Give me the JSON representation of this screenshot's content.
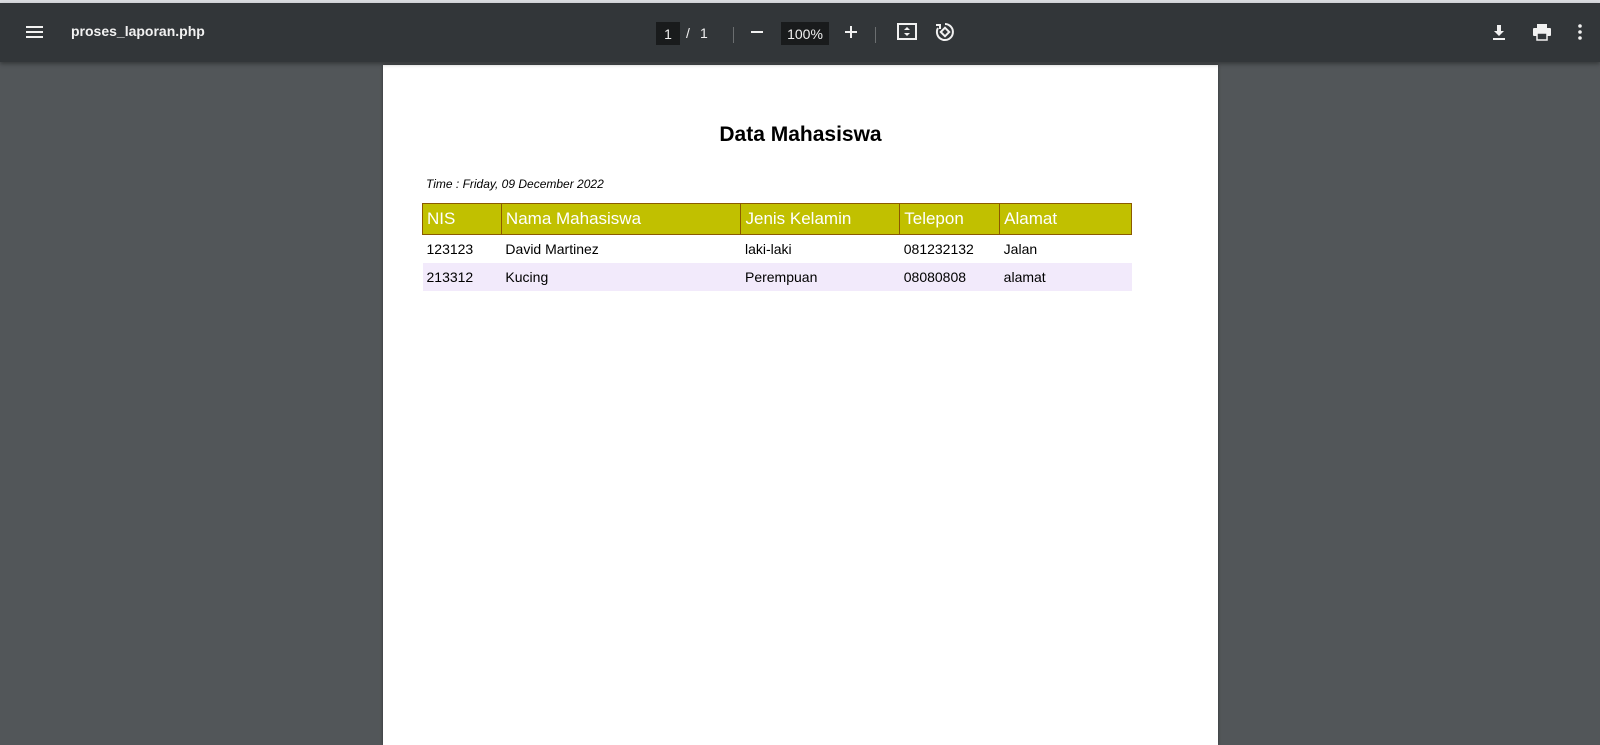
{
  "toolbar": {
    "filename": "proses_laporan.php",
    "page_current": "1",
    "page_separator": "/",
    "page_total": "1",
    "zoom": "100%",
    "icons": {
      "menu": "menu-icon",
      "zoom_out": "minus-icon",
      "zoom_in": "plus-icon",
      "fit": "fit-page-icon",
      "rotate": "rotate-icon",
      "download": "download-icon",
      "print": "print-icon",
      "more": "more-vertical-icon"
    }
  },
  "document": {
    "title": "Data Mahasiswa",
    "time": "Time : Friday, 09 December 2022",
    "table": {
      "headers": [
        "NIS",
        "Nama Mahasiswa",
        "Jenis Kelamin",
        "Telepon",
        "Alamat"
      ],
      "rows": [
        [
          "123123",
          "David Martinez",
          "laki-laki",
          "081232132",
          "Jalan"
        ],
        [
          "213312",
          "Kucing",
          "Perempuan",
          "08080808",
          "alamat"
        ]
      ]
    }
  },
  "colors": {
    "toolbar_bg": "#323639",
    "viewer_bg": "#525659",
    "header_bg": "#c1c000",
    "header_border": "#8b5a00",
    "alt_row_bg": "#f2eafb"
  }
}
